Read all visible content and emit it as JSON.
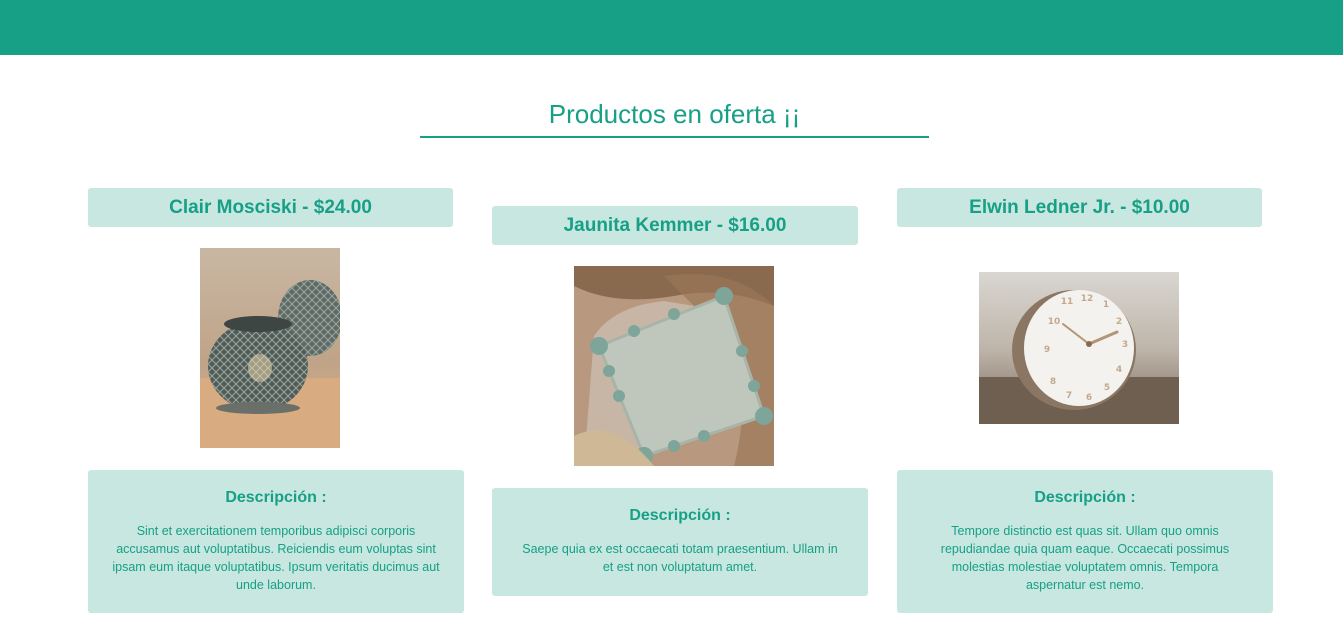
{
  "header": {
    "title": "Productos en oferta ¡¡"
  },
  "products": [
    {
      "name": "Clair Mosciski - $24.00",
      "image_icon": "lantern-image",
      "desc_label": "Descripción :",
      "description": "Sint et exercitationem temporibus adipisci corporis accusamus aut voluptatibus. Reiciendis eum voluptas sint ipsam eum itaque voluptatibus. Ipsum veritatis ducimus aut unde laborum."
    },
    {
      "name": "Jaunita Kemmer - $16.00",
      "image_icon": "cushion-image",
      "desc_label": "Descripción :",
      "description": "Saepe quia ex est occaecati totam praesentium. Ullam in et est non voluptatum amet."
    },
    {
      "name": "Elwin Ledner Jr. - $10.00",
      "image_icon": "clock-image",
      "desc_label": "Descripción :",
      "description": "Tempore distinctio est quas sit. Ullam quo omnis repudiandae quia quam eaque. Occaecati possimus molestias molestiae voluptatem omnis. Tempora aspernatur est nemo."
    }
  ],
  "colors": {
    "accent": "#17a086",
    "card_bg": "#c7e7e0",
    "background": "#ffffff"
  }
}
